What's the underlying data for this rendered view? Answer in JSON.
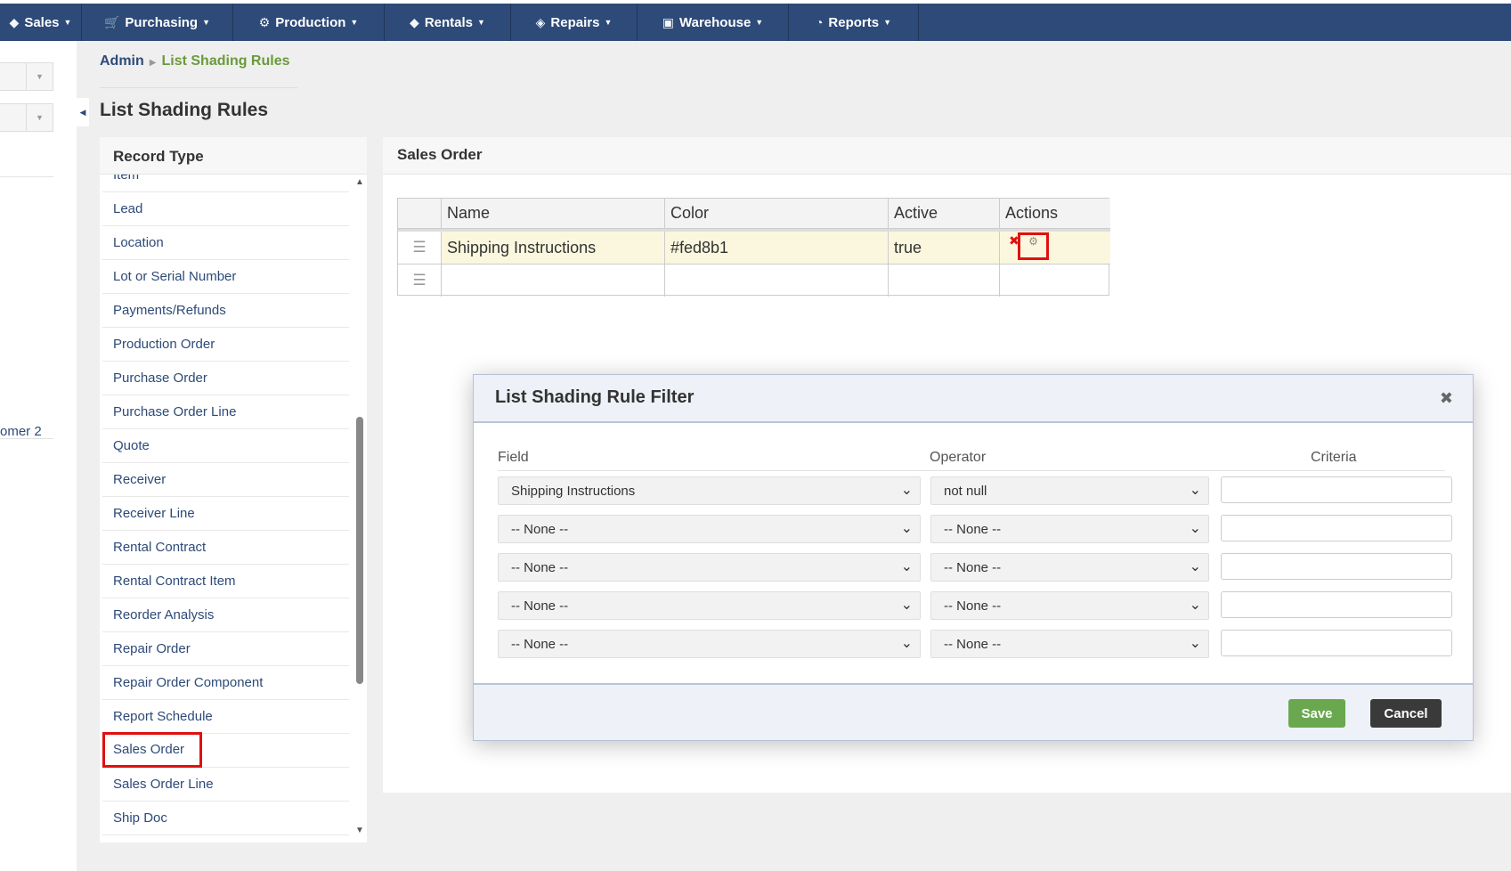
{
  "nav": {
    "items": [
      {
        "label": "Sales",
        "icon": "tag-icon"
      },
      {
        "label": "Purchasing",
        "icon": "cart-icon"
      },
      {
        "label": "Production",
        "icon": "gears-icon"
      },
      {
        "label": "Rentals",
        "icon": "tags-icon"
      },
      {
        "label": "Repairs",
        "icon": "ticket-icon"
      },
      {
        "label": "Warehouse",
        "icon": "cube-icon"
      },
      {
        "label": "Reports",
        "icon": "pie-chart-icon"
      }
    ],
    "background": "#2d4a78"
  },
  "left_strip": {
    "partial_text": "omer 2"
  },
  "breadcrumb": {
    "root": "Admin",
    "current": "List Shading Rules"
  },
  "page": {
    "title": "List Shading Rules"
  },
  "record_type": {
    "header": "Record Type",
    "items": [
      "Item",
      "Lead",
      "Location",
      "Lot or Serial Number",
      "Payments/Refunds",
      "Production Order",
      "Purchase Order",
      "Purchase Order Line",
      "Quote",
      "Receiver",
      "Receiver Line",
      "Rental Contract",
      "Rental Contract Item",
      "Reorder Analysis",
      "Repair Order",
      "Repair Order Component",
      "Report Schedule",
      "Sales Order",
      "Sales Order Line",
      "Ship Doc"
    ],
    "selected": "Sales Order"
  },
  "sales_order": {
    "header": "Sales Order",
    "columns": [
      "Name",
      "Color",
      "Active",
      "Actions"
    ],
    "rows": [
      {
        "name": "Shipping Instructions",
        "color": "#fed8b1",
        "active": "true"
      }
    ],
    "highlight_color": "#fbf7de"
  },
  "modal": {
    "title": "List Shading Rule Filter",
    "col_field": "Field",
    "col_operator": "Operator",
    "col_criteria": "Criteria",
    "rows": [
      {
        "field": "Shipping Instructions",
        "operator": "not null",
        "criteria": ""
      },
      {
        "field": "-- None --",
        "operator": "-- None --",
        "criteria": ""
      },
      {
        "field": "-- None --",
        "operator": "-- None --",
        "criteria": ""
      },
      {
        "field": "-- None --",
        "operator": "-- None --",
        "criteria": ""
      },
      {
        "field": "-- None --",
        "operator": "-- None --",
        "criteria": ""
      }
    ],
    "save_label": "Save",
    "cancel_label": "Cancel",
    "save_color": "#6aa84f",
    "cancel_color": "#3a3a3a"
  }
}
